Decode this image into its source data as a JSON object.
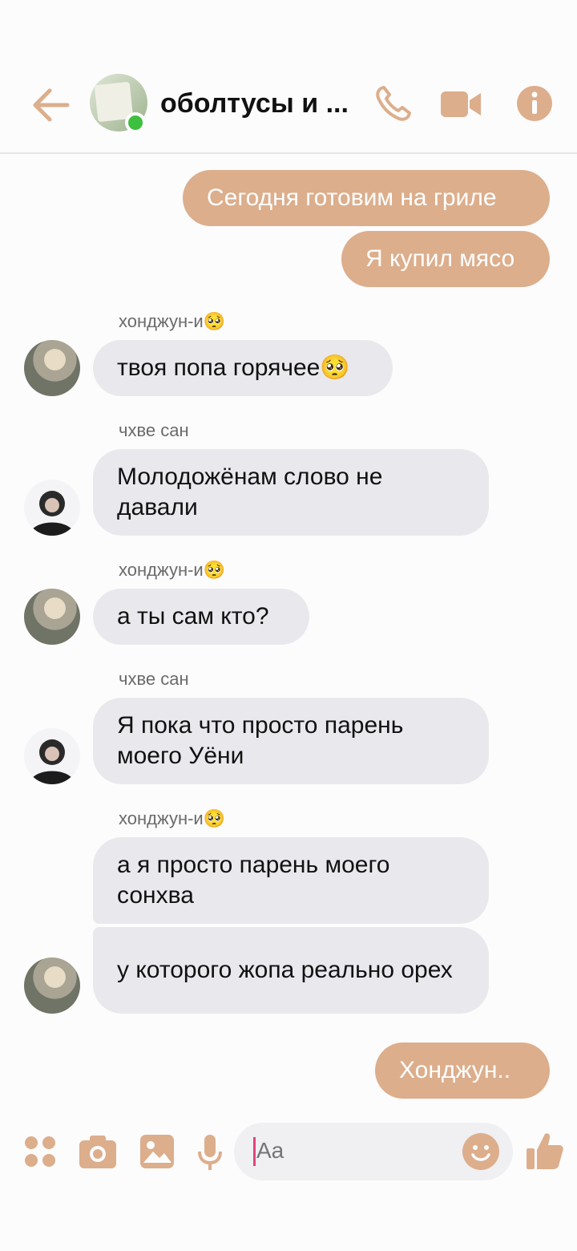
{
  "header": {
    "title": "оболтусы и ..."
  },
  "messages": {
    "m1": "Сегодня готовим на гриле",
    "m2": "Я купил мясо",
    "s1": "хонджун-и🥺",
    "m3": "твоя попа горячее🥺",
    "s2": "чхве сан",
    "m4": "Молодожёнам слово не давали",
    "s3": "хонджун-и🥺",
    "m5": "а ты сам кто?",
    "s4": "чхве сан",
    "m6": "Я пока что просто парень моего Уёни",
    "s5": "хонджун-и🥺",
    "m7": "а я просто парень моего сонхва",
    "m8": "у которого жопа реально орех",
    "m9": "Хонджун.."
  },
  "composer": {
    "placeholder": "Aa"
  },
  "icons": {
    "back": "arrow-left-icon",
    "call": "phone-icon",
    "video": "video-camera-icon",
    "info": "info-icon",
    "apps": "four-dots-icon",
    "camera": "camera-icon",
    "gallery": "image-icon",
    "mic": "microphone-icon",
    "emoji": "smiley-icon",
    "like": "thumbs-up-icon"
  },
  "colors": {
    "accent": "#dcae8c",
    "outgoing_bubble": "#dcae8c",
    "incoming_bubble": "#e9e8ec",
    "online": "#3fbf3f"
  }
}
